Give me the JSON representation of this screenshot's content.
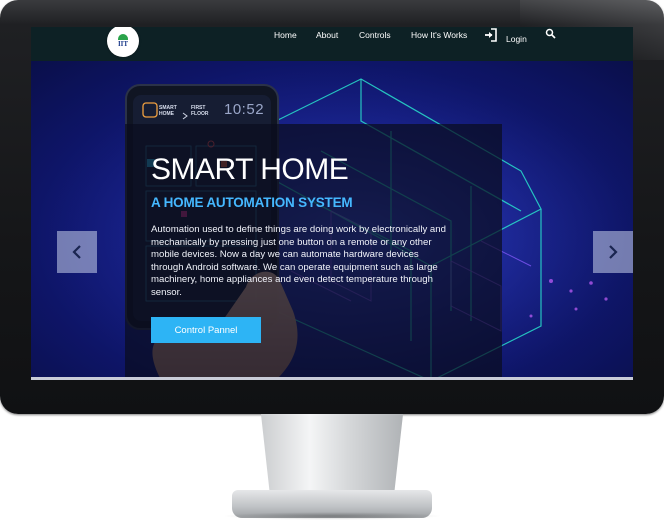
{
  "site": {
    "logo_text": "IIT"
  },
  "nav": {
    "items": [
      {
        "label": "Home"
      },
      {
        "label": "About"
      },
      {
        "label": "Controls"
      },
      {
        "label": "How It's Works"
      }
    ],
    "login_label": "Login"
  },
  "hero": {
    "title": "SMART HOME",
    "subtitle": "A HOME AUTOMATION SYSTEM",
    "description": "Automation used to define things are doing work by electronically and mechanically by pressing just one button on a remote or any other mobile devices. Now a day we can automate hardware devices through Android software. We can operate equipment such as large machinery, home appliances and even detect temperature through sensor.",
    "cta_label": "Control Pannel",
    "phone_label_1": "SMART HOME",
    "phone_label_2": "FIRST FLOOR",
    "phone_time": "10:52"
  },
  "icons": {
    "login": "login-icon",
    "search": "search-icon",
    "prev": "chevron-left-icon",
    "next": "chevron-right-icon"
  },
  "colors": {
    "navbar_bg": "#0d2125",
    "subtitle": "#45b8ff",
    "cta_bg": "#2db4f5",
    "hero_bg": "#1b259a"
  }
}
